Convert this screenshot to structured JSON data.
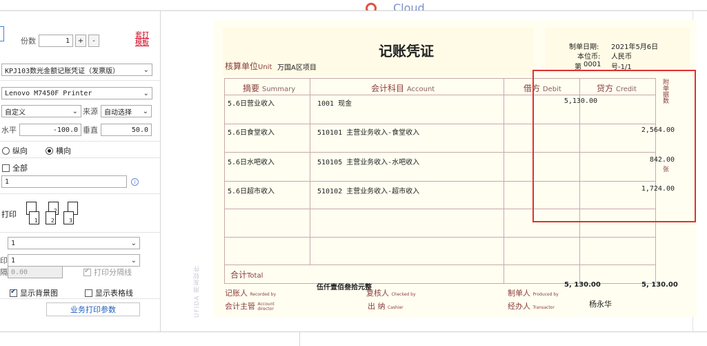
{
  "left": {
    "copies_label": "份数",
    "copies_value": "1",
    "plus_label": "+",
    "minus_label": "-",
    "template_link": "套打模板",
    "template_select": "KPJ103数光金额记账凭证（发票版）",
    "printer_select": "Lenovo M7450F Printer",
    "paper_select": "自定义",
    "source_label": "来源",
    "source_select": "自动选择",
    "horizontal_label": "水平",
    "horizontal_value": "-100.0",
    "vertical_label": "垂直",
    "vertical_value": "50.0",
    "portrait_label": "纵向",
    "landscape_label": "横向",
    "orientation": "landscape",
    "all_label": "全部",
    "range_value": "1",
    "collate_label": "打印",
    "page_icons": [
      "1",
      "2",
      "3"
    ],
    "select1_value": "1",
    "select2_label": "印",
    "select2_value": "1",
    "gap_label": "隔",
    "gap_value": "0.00",
    "print_separator_label": "打印分隔线",
    "print_separator_checked": true,
    "show_bg_label": "显示背景图",
    "show_bg_checked": true,
    "show_grid_label": "显示表格线",
    "show_grid_checked": false,
    "business_params_button": "业务打印参数"
  },
  "top_logo": "Cloud",
  "voucher": {
    "title": "记账凭证",
    "date_label": "制单日期:",
    "date_value": "2021年5月6日",
    "currency_label": "本位币:",
    "currency_value": "人民币",
    "number_label": "第",
    "number_value": "0001",
    "number_suffix": "号-1/1",
    "unit_label": "核算单位",
    "unit_label_en": "Unit",
    "unit_value": "万国A区项目",
    "col_summary": "摘要",
    "col_summary_en": "Summary",
    "col_account": "会计科目",
    "col_account_en": "Account",
    "col_debit": "借方",
    "col_debit_en": "Debit",
    "col_credit": "贷方",
    "col_credit_en": "Credit",
    "attachments_vertical": "附单据数",
    "sheets_vertical": "张",
    "rows": [
      {
        "summary": "5.6日营业收入",
        "account": "1001 现金",
        "debit": "5,130.00",
        "credit": ""
      },
      {
        "summary": "5.6日食堂收入",
        "account": "510101 主营业务收入-食堂收入",
        "debit": "",
        "credit": "2,564.00"
      },
      {
        "summary": "5.6日水吧收入",
        "account": "510105 主营业务收入-水吧收入",
        "debit": "",
        "credit": "842.00"
      },
      {
        "summary": "5.6日超市收入",
        "account": "510102 主营业务收入-超市收入",
        "debit": "",
        "credit": "1,724.00"
      }
    ],
    "total_label": "合计",
    "total_label_en": "Total",
    "total_words": "伍仟壹佰叁拾元整",
    "total_debit": "5, 130.00",
    "total_credit": "5, 130.00",
    "recorded_by_label": "记账人",
    "recorded_by_en": "Recorded by",
    "checked_by_label": "复核人",
    "checked_by_en": "Checked by",
    "produced_by_label": "制单人",
    "produced_by_en": "Produced by",
    "director_label": "会计主管",
    "director_en": "Account director",
    "cashier_label": "出  纳",
    "cashier_en": "Cashier",
    "transactor_label": "经办人",
    "transactor_en": "Transactor",
    "transactor_value": "杨永华",
    "watermark": "UFIDA 用友软件"
  },
  "colors": {
    "highlight_box": "#e03030",
    "template_link": "#d0021b",
    "voucher_bg": "#fffef1",
    "voucher_accent": "#8a3c3c",
    "button_link": "#1f5fc1"
  }
}
